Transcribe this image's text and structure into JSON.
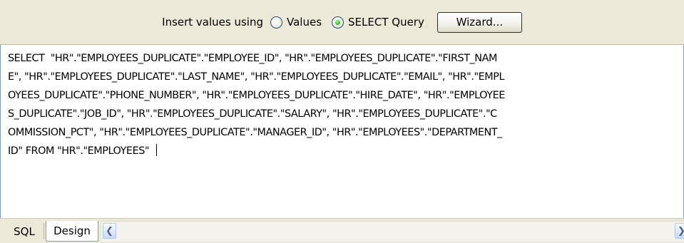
{
  "toolbar": {
    "prompt": "Insert values using",
    "options": [
      {
        "label": "Values",
        "checked": false
      },
      {
        "label": "SELECT Query",
        "checked": true
      }
    ],
    "wizard_label": "Wizard..."
  },
  "editor": {
    "lines": [
      "SELECT  \"HR\".\"EMPLOYEES_DUPLICATE\".\"EMPLOYEE_ID\", \"HR\".\"EMPLOYEES_DUPLICATE\".\"FIRST_NAM",
      "E\", \"HR\".\"EMPLOYEES_DUPLICATE\".\"LAST_NAME\", \"HR\".\"EMPLOYEES_DUPLICATE\".\"EMAIL\", \"HR\".\"EMPL",
      "OYEES_DUPLICATE\".\"PHONE_NUMBER\", \"HR\".\"EMPLOYEES_DUPLICATE\".\"HIRE_DATE\", \"HR\".\"EMPLOYEE",
      "S_DUPLICATE\".\"JOB_ID\", \"HR\".\"EMPLOYEES_DUPLICATE\".\"SALARY\", \"HR\".\"EMPLOYEES_DUPLICATE\".\"C",
      "OMMISSION_PCT\", \"HR\".\"EMPLOYEES_DUPLICATE\".\"MANAGER_ID\", \"HR\".\"EMPLOYEES\".\"DEPARTMENT_",
      "ID\" FROM \"HR\".\"EMPLOYEES\"  "
    ]
  },
  "tabs": [
    {
      "label": "SQL",
      "active": false
    },
    {
      "label": "Design",
      "active": true
    }
  ],
  "scrollbar": {
    "left_icon": "chevron-left-icon",
    "right_icon": "chevron-right-icon"
  }
}
